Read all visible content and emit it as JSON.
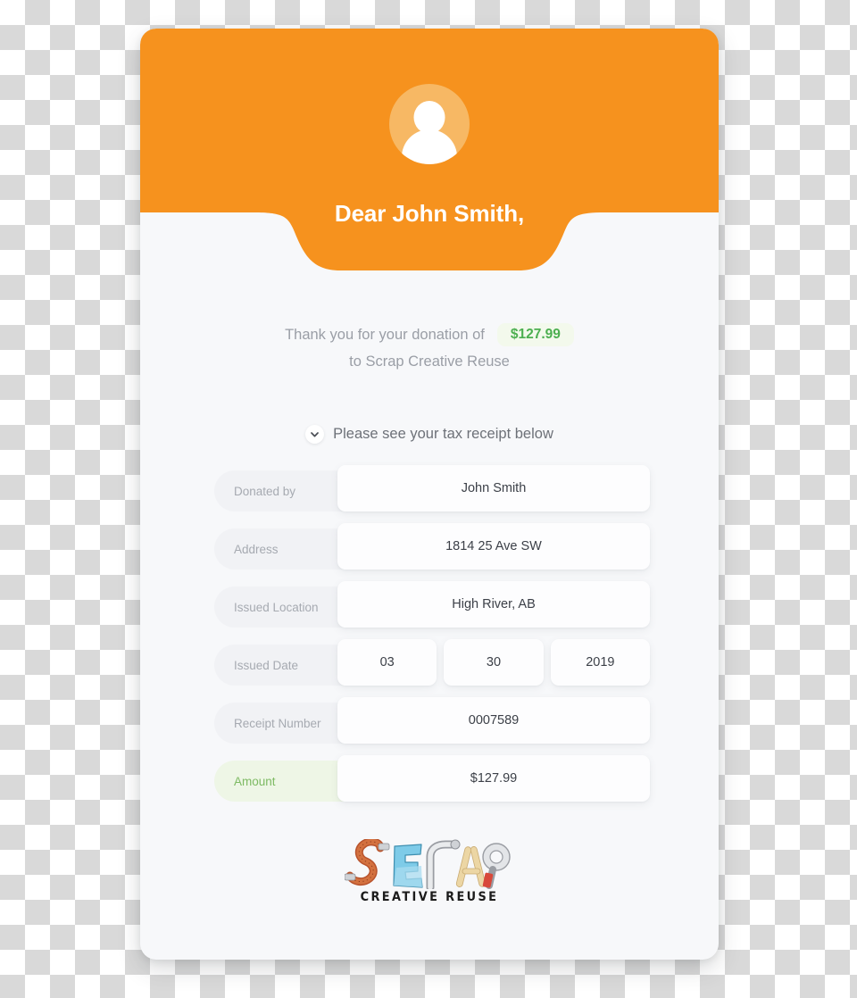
{
  "card": {
    "header": {
      "avatar_icon": "user-avatar-icon",
      "greeting": "Dear John Smith,",
      "background_color": "#f6921e",
      "avatar_color": "#f7b864"
    },
    "thanks": {
      "line1_prefix": "Thank you for your donation of",
      "amount": "$127.99",
      "line2": "to Scrap Creative Reuse",
      "amount_color": "#4caf50",
      "amount_pill_background": "#f3f9ec"
    },
    "disclosure": {
      "icon": "chevron-down-icon",
      "label": "Please see your tax receipt below"
    },
    "fields": [
      {
        "label": "Donated by",
        "values": [
          "John Smith"
        ],
        "highlight": false
      },
      {
        "label": "Address",
        "values": [
          "1814 25 Ave SW"
        ],
        "highlight": false
      },
      {
        "label": "Issued Location",
        "values": [
          "High River, AB"
        ],
        "highlight": false
      },
      {
        "label": "Issued Date",
        "values": [
          "03",
          "30",
          "2019"
        ],
        "highlight": false
      },
      {
        "label": "Receipt Number",
        "values": [
          "0007589"
        ],
        "highlight": false
      },
      {
        "label": "Amount",
        "values": [
          "$127.99"
        ],
        "highlight": true
      }
    ],
    "logo": {
      "wordmark": "SCRAP",
      "tagline": "CREATIVE REUSE",
      "letters": [
        {
          "char": "S",
          "material": "measuring-tape",
          "color": "#c0522c"
        },
        {
          "char": "C",
          "material": "blue-paper",
          "color": "#74c7e8"
        },
        {
          "char": "R",
          "material": "pipe",
          "color": "#d8d8da"
        },
        {
          "char": "A",
          "material": "popsicle-sticks",
          "color": "#e8cf9a"
        },
        {
          "char": "P",
          "material": "tape-spool",
          "color": "#c9cace"
        }
      ]
    }
  }
}
